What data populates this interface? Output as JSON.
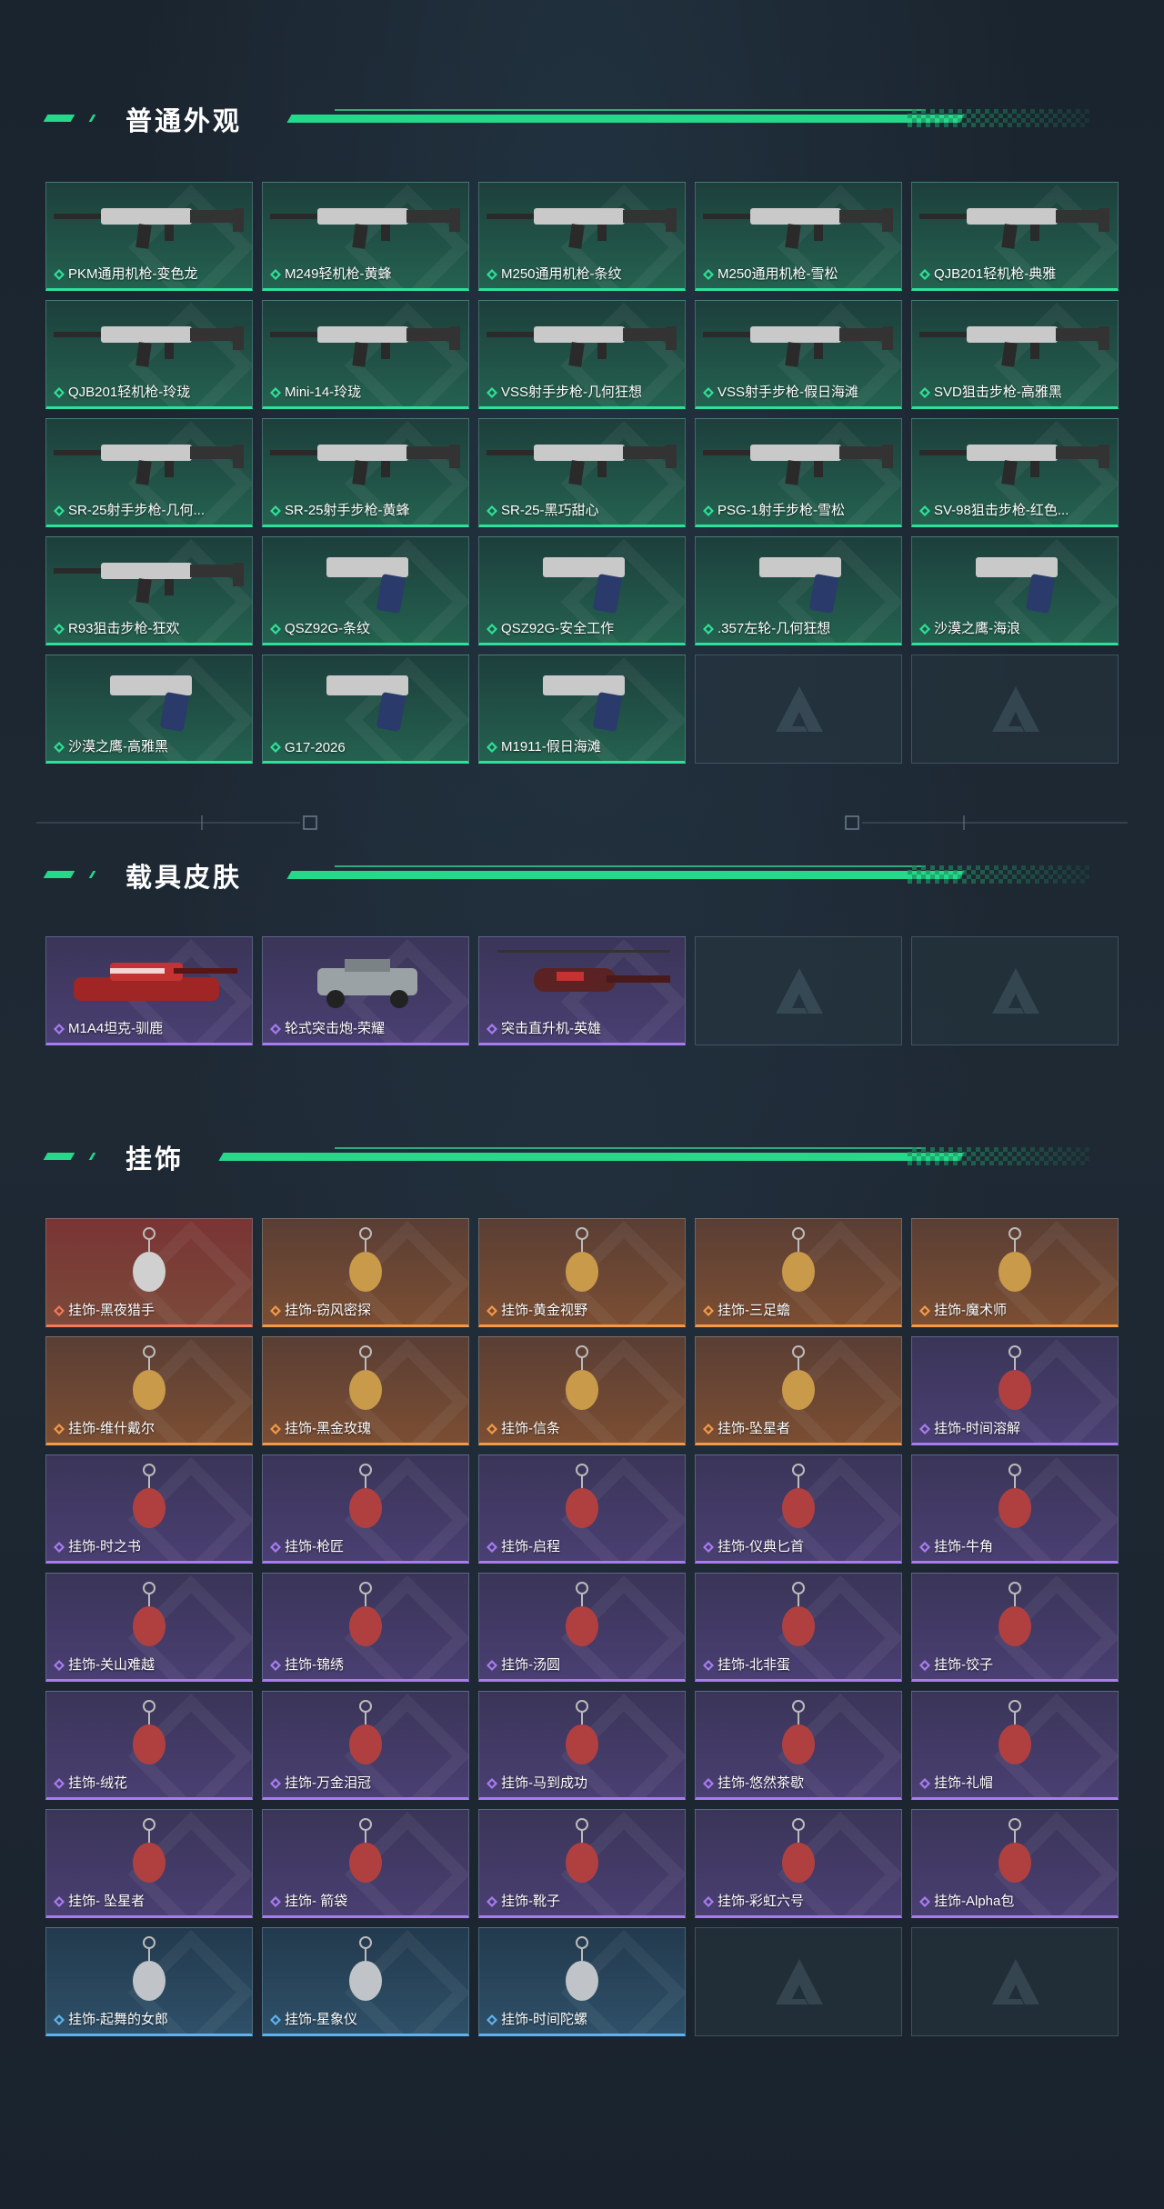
{
  "colors": {
    "accent_green": "#25d88a",
    "rarity_green": "#2fe09a",
    "rarity_purple": "#a77cf0",
    "rarity_orange": "#f29a49",
    "rarity_red": "#f07a5a",
    "rarity_blue": "#5fb2ee"
  },
  "sections": {
    "weapons": {
      "title": "普通外观",
      "items": [
        {
          "label": "PKM通用机枪-变色龙",
          "rarity": "green",
          "icon": "machine-gun-icon"
        },
        {
          "label": "M249轻机枪-黄蜂",
          "rarity": "green",
          "icon": "machine-gun-icon"
        },
        {
          "label": "M250通用机枪-条纹",
          "rarity": "green",
          "icon": "machine-gun-icon"
        },
        {
          "label": "M250通用机枪-雪松",
          "rarity": "green",
          "icon": "machine-gun-icon"
        },
        {
          "label": "QJB201轻机枪-典雅",
          "rarity": "green",
          "icon": "machine-gun-icon"
        },
        {
          "label": "QJB201轻机枪-玲珑",
          "rarity": "green",
          "icon": "machine-gun-icon"
        },
        {
          "label": "Mini-14-玲珑",
          "rarity": "green",
          "icon": "rifle-icon"
        },
        {
          "label": "VSS射手步枪-几何狂想",
          "rarity": "green",
          "icon": "rifle-icon"
        },
        {
          "label": "VSS射手步枪-假日海滩",
          "rarity": "green",
          "icon": "rifle-icon"
        },
        {
          "label": "SVD狙击步枪-高雅黑",
          "rarity": "green",
          "icon": "rifle-icon"
        },
        {
          "label": "SR-25射手步枪-几何...",
          "rarity": "green",
          "icon": "rifle-icon"
        },
        {
          "label": "SR-25射手步枪-黄蜂",
          "rarity": "green",
          "icon": "rifle-icon"
        },
        {
          "label": "SR-25-黑巧甜心",
          "rarity": "green",
          "icon": "rifle-icon"
        },
        {
          "label": "PSG-1射手步枪-雪松",
          "rarity": "green",
          "icon": "rifle-icon"
        },
        {
          "label": "SV-98狙击步枪-红色...",
          "rarity": "green",
          "icon": "rifle-icon"
        },
        {
          "label": "R93狙击步枪-狂欢",
          "rarity": "green",
          "icon": "rifle-icon"
        },
        {
          "label": "QSZ92G-条纹",
          "rarity": "green",
          "icon": "pistol-icon"
        },
        {
          "label": "QSZ92G-安全工作",
          "rarity": "green",
          "icon": "pistol-icon"
        },
        {
          "label": ".357左轮-几何狂想",
          "rarity": "green",
          "icon": "revolver-icon"
        },
        {
          "label": "沙漠之鹰-海浪",
          "rarity": "green",
          "icon": "pistol-icon"
        },
        {
          "label": "沙漠之鹰-高雅黑",
          "rarity": "green",
          "icon": "pistol-icon"
        },
        {
          "label": "G17-2026",
          "rarity": "green",
          "icon": "pistol-icon"
        },
        {
          "label": "M1911-假日海滩",
          "rarity": "green",
          "icon": "pistol-icon"
        },
        {
          "label": "",
          "rarity": "empty",
          "icon": "placeholder-logo-icon"
        },
        {
          "label": "",
          "rarity": "empty",
          "icon": "placeholder-logo-icon"
        }
      ]
    },
    "vehicles": {
      "title": "载具皮肤",
      "items": [
        {
          "label": "M1A4坦克-驯鹿",
          "rarity": "purple",
          "icon": "tank-icon"
        },
        {
          "label": "轮式突击炮-荣耀",
          "rarity": "purple",
          "icon": "armored-car-icon"
        },
        {
          "label": "突击直升机-英雄",
          "rarity": "purple",
          "icon": "helicopter-icon"
        },
        {
          "label": "",
          "rarity": "empty",
          "icon": "placeholder-logo-icon"
        },
        {
          "label": "",
          "rarity": "empty",
          "icon": "placeholder-logo-icon"
        }
      ]
    },
    "charms": {
      "title": "挂饰",
      "items": [
        {
          "label": "挂饰-黑夜猎手",
          "rarity": "red",
          "icon": "charm-icon"
        },
        {
          "label": "挂饰-窃风密探",
          "rarity": "orange",
          "icon": "charm-icon"
        },
        {
          "label": "挂饰-黄金视野",
          "rarity": "orange",
          "icon": "charm-icon"
        },
        {
          "label": "挂饰-三足蟾",
          "rarity": "orange",
          "icon": "charm-icon"
        },
        {
          "label": "挂饰-魔术师",
          "rarity": "orange",
          "icon": "charm-icon"
        },
        {
          "label": "挂饰-维什戴尔",
          "rarity": "orange",
          "icon": "charm-icon"
        },
        {
          "label": "挂饰-黑金玫瑰",
          "rarity": "orange",
          "icon": "charm-icon"
        },
        {
          "label": "挂饰-信条",
          "rarity": "orange",
          "icon": "charm-icon"
        },
        {
          "label": "挂饰-坠星者",
          "rarity": "orange",
          "icon": "charm-icon"
        },
        {
          "label": "挂饰-时间溶解",
          "rarity": "purple",
          "icon": "charm-icon"
        },
        {
          "label": "挂饰-时之书",
          "rarity": "purple",
          "icon": "charm-icon"
        },
        {
          "label": "挂饰-枪匠",
          "rarity": "purple",
          "icon": "charm-icon"
        },
        {
          "label": "挂饰-启程",
          "rarity": "purple",
          "icon": "charm-icon"
        },
        {
          "label": "挂饰-仪典匕首",
          "rarity": "purple",
          "icon": "charm-icon"
        },
        {
          "label": "挂饰-牛角",
          "rarity": "purple",
          "icon": "charm-icon"
        },
        {
          "label": "挂饰-关山难越",
          "rarity": "purple",
          "icon": "charm-icon"
        },
        {
          "label": "挂饰-锦绣",
          "rarity": "purple",
          "icon": "charm-icon"
        },
        {
          "label": "挂饰-汤圆",
          "rarity": "purple",
          "icon": "charm-icon"
        },
        {
          "label": "挂饰-北非蛋",
          "rarity": "purple",
          "icon": "charm-icon"
        },
        {
          "label": "挂饰-饺子",
          "rarity": "purple",
          "icon": "charm-icon"
        },
        {
          "label": "挂饰-绒花",
          "rarity": "purple",
          "icon": "charm-icon"
        },
        {
          "label": "挂饰-万金泪冠",
          "rarity": "purple",
          "icon": "charm-icon"
        },
        {
          "label": "挂饰-马到成功",
          "rarity": "purple",
          "icon": "charm-icon"
        },
        {
          "label": "挂饰-悠然茶歇",
          "rarity": "purple",
          "icon": "charm-icon"
        },
        {
          "label": "挂饰-礼帽",
          "rarity": "purple",
          "icon": "charm-icon"
        },
        {
          "label": "挂饰- 坠星者",
          "rarity": "purple",
          "icon": "charm-icon"
        },
        {
          "label": "挂饰- 箭袋",
          "rarity": "purple",
          "icon": "charm-icon"
        },
        {
          "label": "挂饰-靴子",
          "rarity": "purple",
          "icon": "charm-icon"
        },
        {
          "label": "挂饰-彩虹六号",
          "rarity": "purple",
          "icon": "charm-icon"
        },
        {
          "label": "挂饰-Alpha包",
          "rarity": "purple",
          "icon": "charm-icon"
        },
        {
          "label": "挂饰-起舞的女郎",
          "rarity": "blue",
          "icon": "charm-icon"
        },
        {
          "label": "挂饰-星象仪",
          "rarity": "blue",
          "icon": "charm-icon"
        },
        {
          "label": "挂饰-时间陀螺",
          "rarity": "blue",
          "icon": "charm-icon"
        },
        {
          "label": "",
          "rarity": "empty",
          "icon": "placeholder-logo-icon"
        },
        {
          "label": "",
          "rarity": "empty",
          "icon": "placeholder-logo-icon"
        }
      ]
    }
  }
}
